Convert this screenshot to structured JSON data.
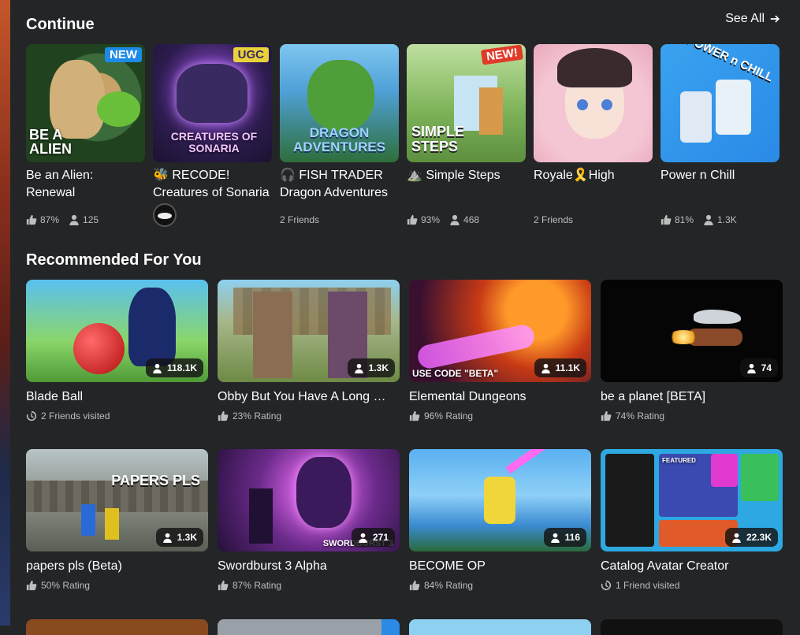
{
  "continue": {
    "title": "Continue",
    "see_all": "See All",
    "items": [
      {
        "title": "Be an Alien: Renewal",
        "badge": "NEW",
        "thumb_text": "BE A ALIEN",
        "rating": "87%",
        "players": "125"
      },
      {
        "title": "🐝 RECODE! Creatures of Sonaria",
        "badge": "UGC",
        "thumb_text": "CREATURES OF SONARIA"
      },
      {
        "title": "🎧 FISH TRADER Dragon Adventures",
        "thumb_text": "DRAGON ADVENTURES",
        "friends": "2 Friends"
      },
      {
        "title": "⛰️ Simple Steps",
        "badge": "NEW!",
        "thumb_text": "SIMPLE STEPS",
        "rating": "93%",
        "players": "468"
      },
      {
        "title": "Royale🎗️High",
        "friends": "2 Friends"
      },
      {
        "title": "Power n Chill",
        "thumb_text": "POWER n CHILL",
        "rating": "81%",
        "players": "1.3K"
      }
    ]
  },
  "recommended": {
    "title": "Recommended For You",
    "items": [
      {
        "title": "Blade Ball",
        "players": "118.1K",
        "meta": "2 Friends visited",
        "meta_type": "visited"
      },
      {
        "title": "Obby But You Have A Long …",
        "players": "1.3K",
        "meta": "23% Rating",
        "meta_type": "rating"
      },
      {
        "title": "Elemental Dungeons",
        "players": "11.1K",
        "meta": "96% Rating",
        "meta_type": "rating",
        "thumb_text": "USE CODE \"BETA\""
      },
      {
        "title": "be a planet [BETA]",
        "players": "74",
        "meta": "74% Rating",
        "meta_type": "rating"
      },
      {
        "title": "papers pls (Beta)",
        "players": "1.3K",
        "meta": "50% Rating",
        "meta_type": "rating",
        "thumb_text": "PAPERS PLS"
      },
      {
        "title": "Swordburst 3 Alpha",
        "players": "271",
        "meta": "87% Rating",
        "meta_type": "rating",
        "thumb_text": "SWORDBURST 3"
      },
      {
        "title": "BECOME OP",
        "players": "116",
        "meta": "84% Rating",
        "meta_type": "rating"
      },
      {
        "title": "Catalog Avatar Creator",
        "players": "22.3K",
        "meta": "1 Friend visited",
        "meta_type": "visited",
        "thumb_text": "FEATURED"
      }
    ]
  }
}
